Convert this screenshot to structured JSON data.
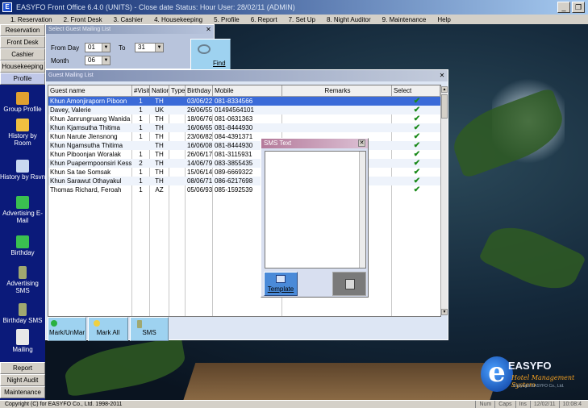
{
  "window": {
    "title": "EASYFO Front Office 6.4.0 (UNITS) - Close date Status: Hour User: 28/02/11 (ADMIN)"
  },
  "menu": [
    "1. Reservation",
    "2. Front Desk",
    "3. Cashier",
    "4. Housekeeping",
    "5. Profile",
    "6. Report",
    "7. Set Up",
    "8. Night Auditor",
    "9. Maintenance",
    "Help"
  ],
  "leftnav": {
    "top_buttons": [
      "Reservation",
      "Front Desk",
      "Cashier",
      "Housekeeping",
      "Profile"
    ],
    "icon_items": [
      {
        "label": "Group Profile",
        "icon": "group-profile-icon"
      },
      {
        "label": "History by Room",
        "icon": "history-room-icon"
      },
      {
        "label": "History by Rsvn",
        "icon": "history-rsvn-icon"
      },
      {
        "label": "Advertising E-Mail",
        "icon": "email-icon"
      },
      {
        "label": "Birthday",
        "icon": "birthday-icon"
      },
      {
        "label": "Advertising SMS",
        "icon": "sms-phone-icon"
      },
      {
        "label": "Birthday SMS",
        "icon": "birthday-sms-icon"
      },
      {
        "label": "Mailing",
        "icon": "mailing-icon"
      }
    ],
    "bottom_buttons": [
      "Report",
      "Night Audit",
      "Maintenance"
    ]
  },
  "select_panel": {
    "caption": "Select Guest Mailing List",
    "from_day_label": "From Day",
    "from_day_value": "01",
    "to_label": "To",
    "to_value": "31",
    "month_label": "Month",
    "month_value": "06",
    "find_label": "Find"
  },
  "list_window": {
    "caption": "Guest Mailing List",
    "columns": [
      "Guest name",
      "#Visit",
      "Nation",
      "Type",
      "Birthday",
      "Mobile",
      "Remarks",
      "Select"
    ],
    "rows": [
      {
        "name": "Khun Amonjiraporn Piboon",
        "visit": "1",
        "nation": "TH",
        "type": "",
        "birthday": "03/06/22",
        "mobile": "081-8334566",
        "remarks": "",
        "select": true
      },
      {
        "name": "Davey,  Valerie",
        "visit": "1",
        "nation": "UK",
        "type": "",
        "birthday": "26/06/55",
        "mobile": "01494564101",
        "remarks": "",
        "select": true
      },
      {
        "name": "Khun Janrungruang Wanida",
        "visit": "1",
        "nation": "TH",
        "type": "",
        "birthday": "18/06/76",
        "mobile": "081-0631363",
        "remarks": "",
        "select": true
      },
      {
        "name": "Khun Kjamsutha Thitima",
        "visit": "1",
        "nation": "TH",
        "type": "",
        "birthday": "16/06/65",
        "mobile": "081-8444930",
        "remarks": "",
        "select": true
      },
      {
        "name": "Khun Narute Jlensnong",
        "visit": "1",
        "nation": "TH",
        "type": "",
        "birthday": "23/06/82",
        "mobile": "084-4391371",
        "remarks": "",
        "select": true
      },
      {
        "name": "Khun Ngamsutha Thitima",
        "visit": "",
        "nation": "TH",
        "type": "",
        "birthday": "16/06/08",
        "mobile": "081-8444930",
        "remarks": "",
        "select": true
      },
      {
        "name": "Khun Piboonjan Woralak",
        "visit": "1",
        "nation": "TH",
        "type": "",
        "birthday": "26/06/17",
        "mobile": "081-3115931",
        "remarks": "",
        "select": true
      },
      {
        "name": "Khun Puapermpoonsiri Kessuda",
        "visit": "2",
        "nation": "TH",
        "type": "",
        "birthday": "14/06/79",
        "mobile": "083-3855435",
        "remarks": "",
        "select": true
      },
      {
        "name": "Khun Sa tae Somsak",
        "visit": "1",
        "nation": "TH",
        "type": "",
        "birthday": "15/06/14",
        "mobile": "089-6669322",
        "remarks": "",
        "select": true
      },
      {
        "name": "Khun Sarawut Othayakul",
        "visit": "1",
        "nation": "TH",
        "type": "",
        "birthday": "08/06/71",
        "mobile": "086-6217698",
        "remarks": "",
        "select": true
      },
      {
        "name": "Thomas Richard,  Feroah",
        "visit": "1",
        "nation": "AZ",
        "type": "",
        "birthday": "05/06/93",
        "mobile": "085-1592539",
        "remarks": "",
        "select": true
      }
    ],
    "buttons": {
      "mark_unmark": "Mark/UnMar",
      "mark_all": "Mark All",
      "sms": "SMS"
    }
  },
  "sms_dialog": {
    "caption": "SMS Text",
    "template_label": "Template"
  },
  "logo": {
    "letter": "e",
    "brand": "EASYFO",
    "tagline": "Hotel Management System",
    "sub": "Copyright EASYFO Co., Ltd."
  },
  "statusbar": {
    "copyright": "Copyright (C) for EASYFO Co., Ltd. 1998-2011",
    "cells": [
      "Num",
      "Caps",
      "Ins",
      "12/02/11",
      "10:08:4"
    ]
  },
  "colors": {
    "selected_row": "#3a6ad8",
    "check": "#1a8a1a",
    "button_blue": "#9ed2f0"
  }
}
